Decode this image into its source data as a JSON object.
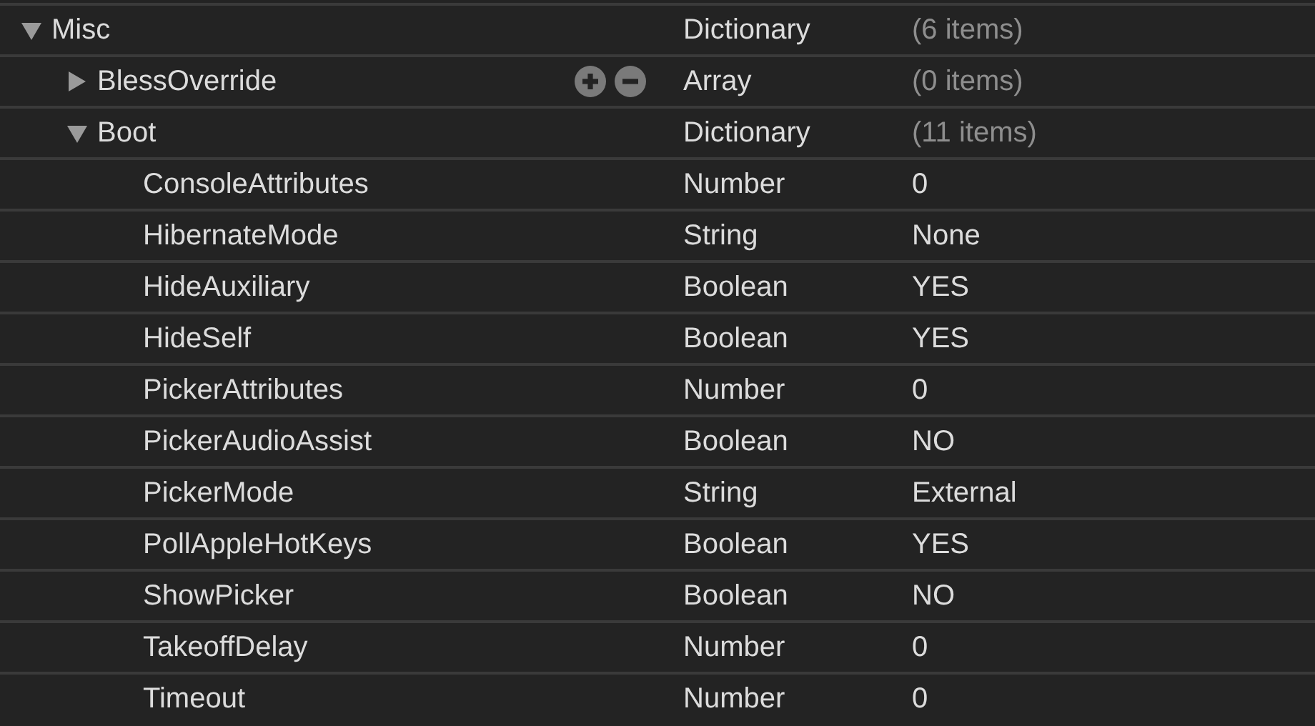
{
  "tree": [
    {
      "key": "Misc",
      "type": "Dictionary",
      "value": "(6 items)",
      "kind": "container",
      "expanded": true,
      "show_controls": false,
      "children": [
        {
          "key": "BlessOverride",
          "type": "Array",
          "value": "(0 items)",
          "kind": "container",
          "expanded": false,
          "show_controls": true
        },
        {
          "key": "Boot",
          "type": "Dictionary",
          "value": "(11 items)",
          "kind": "container",
          "expanded": true,
          "show_controls": false,
          "children": [
            {
              "key": "ConsoleAttributes",
              "type": "Number",
              "value": "0",
              "kind": "scalar",
              "show_controls": false
            },
            {
              "key": "HibernateMode",
              "type": "String",
              "value": "None",
              "kind": "scalar",
              "show_controls": false
            },
            {
              "key": "HideAuxiliary",
              "type": "Boolean",
              "value": "YES",
              "kind": "scalar",
              "show_controls": false
            },
            {
              "key": "HideSelf",
              "type": "Boolean",
              "value": "YES",
              "kind": "scalar",
              "show_controls": false
            },
            {
              "key": "PickerAttributes",
              "type": "Number",
              "value": "0",
              "kind": "scalar",
              "show_controls": false
            },
            {
              "key": "PickerAudioAssist",
              "type": "Boolean",
              "value": "NO",
              "kind": "scalar",
              "show_controls": false
            },
            {
              "key": "PickerMode",
              "type": "String",
              "value": "External",
              "kind": "scalar",
              "show_controls": false
            },
            {
              "key": "PollAppleHotKeys",
              "type": "Boolean",
              "value": "YES",
              "kind": "scalar",
              "show_controls": false
            },
            {
              "key": "ShowPicker",
              "type": "Boolean",
              "value": "NO",
              "kind": "scalar",
              "show_controls": false
            },
            {
              "key": "TakeoffDelay",
              "type": "Number",
              "value": "0",
              "kind": "scalar",
              "show_controls": false
            },
            {
              "key": "Timeout",
              "type": "Number",
              "value": "0",
              "kind": "scalar",
              "show_controls": false
            }
          ]
        }
      ]
    }
  ]
}
